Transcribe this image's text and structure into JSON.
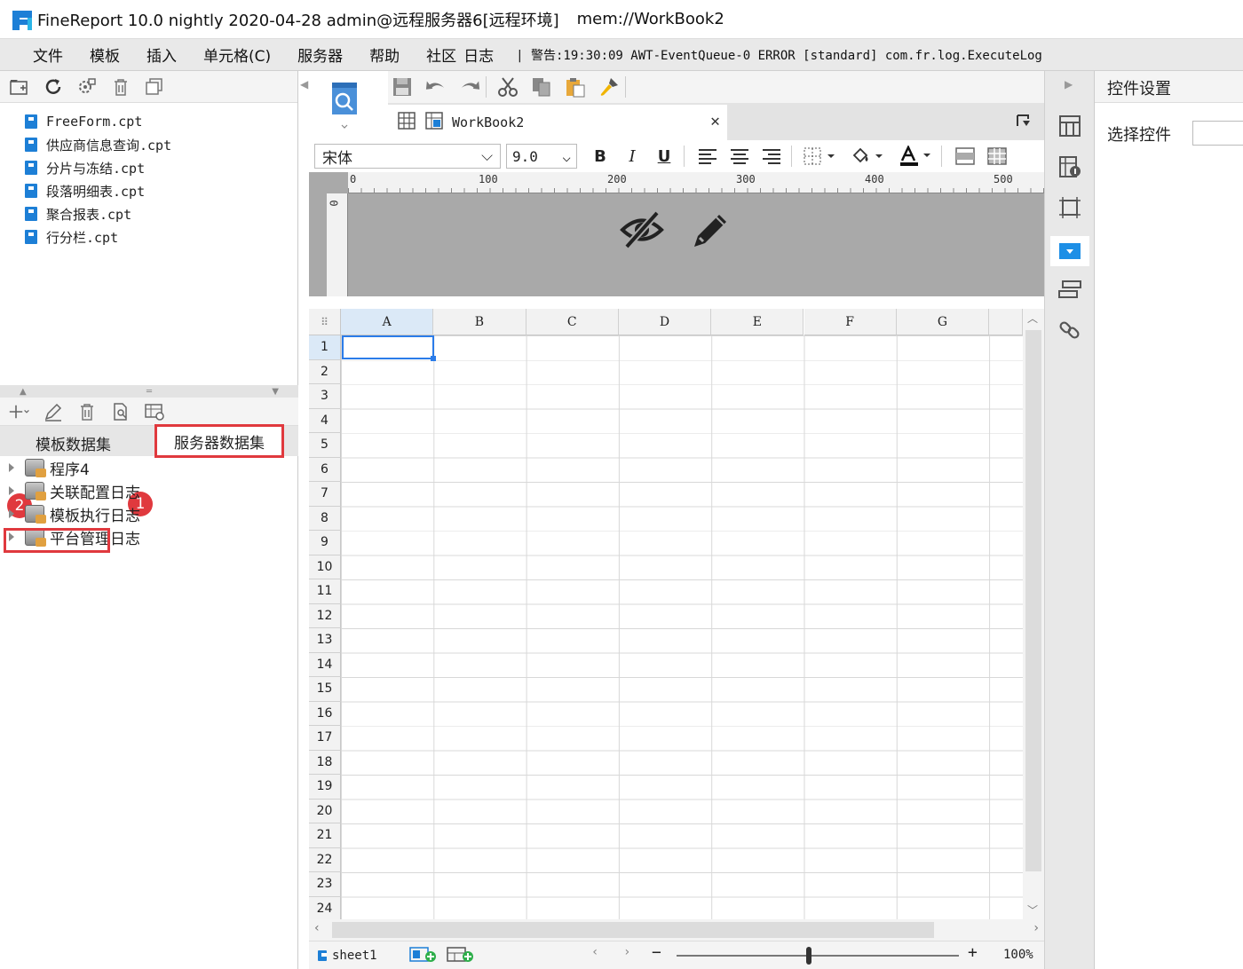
{
  "window": {
    "title": "FineReport 10.0 nightly 2020-04-28 admin@远程服务器6[远程环境]",
    "path": "mem://WorkBook2"
  },
  "menu": {
    "items": [
      "文件",
      "模板",
      "插入",
      "单元格(C)",
      "服务器",
      "帮助",
      "社区",
      "日志"
    ],
    "log_message": "| 警告:19:30:09 AWT-EventQueue-0 ERROR [standard] com.fr.log.ExecuteLog"
  },
  "file_tree": {
    "files": [
      "FreeForm.cpt",
      "供应商信息查询.cpt",
      "分片与冻结.cpt",
      "段落明细表.cpt",
      "聚合报表.cpt",
      "行分栏.cpt"
    ]
  },
  "datasets": {
    "tab_template": "模板数据集",
    "tab_server": "服务器数据集",
    "badge_1": "1",
    "badge_2": "2",
    "items": [
      "程序4",
      "关联配置日志",
      "模板执行日志",
      "平台管理日志"
    ]
  },
  "editor": {
    "tab_label": "WorkBook2",
    "font_name": "宋体",
    "font_size": "9.0",
    "bold": "B",
    "italic": "I",
    "underline": "U",
    "ruler_marks": [
      "0",
      "100",
      "200",
      "300",
      "400",
      "500"
    ],
    "ruler_v_mark": "0",
    "columns": [
      "A",
      "B",
      "C",
      "D",
      "E",
      "F",
      "G"
    ],
    "rows": [
      "1",
      "2",
      "3",
      "4",
      "5",
      "6",
      "7",
      "8",
      "9",
      "10",
      "11",
      "12",
      "13",
      "14",
      "15",
      "16",
      "17",
      "18",
      "19",
      "20",
      "21",
      "22",
      "23",
      "24"
    ],
    "sheet_name": "sheet1",
    "zoom": "100%",
    "zoom_level": 0.47
  },
  "right_panel": {
    "title": "控件设置",
    "select_label": "选择控件"
  },
  "colors": {
    "accent": "#1d7fd6",
    "highlight": "#e0393e",
    "selection": "#2b7ce9"
  }
}
